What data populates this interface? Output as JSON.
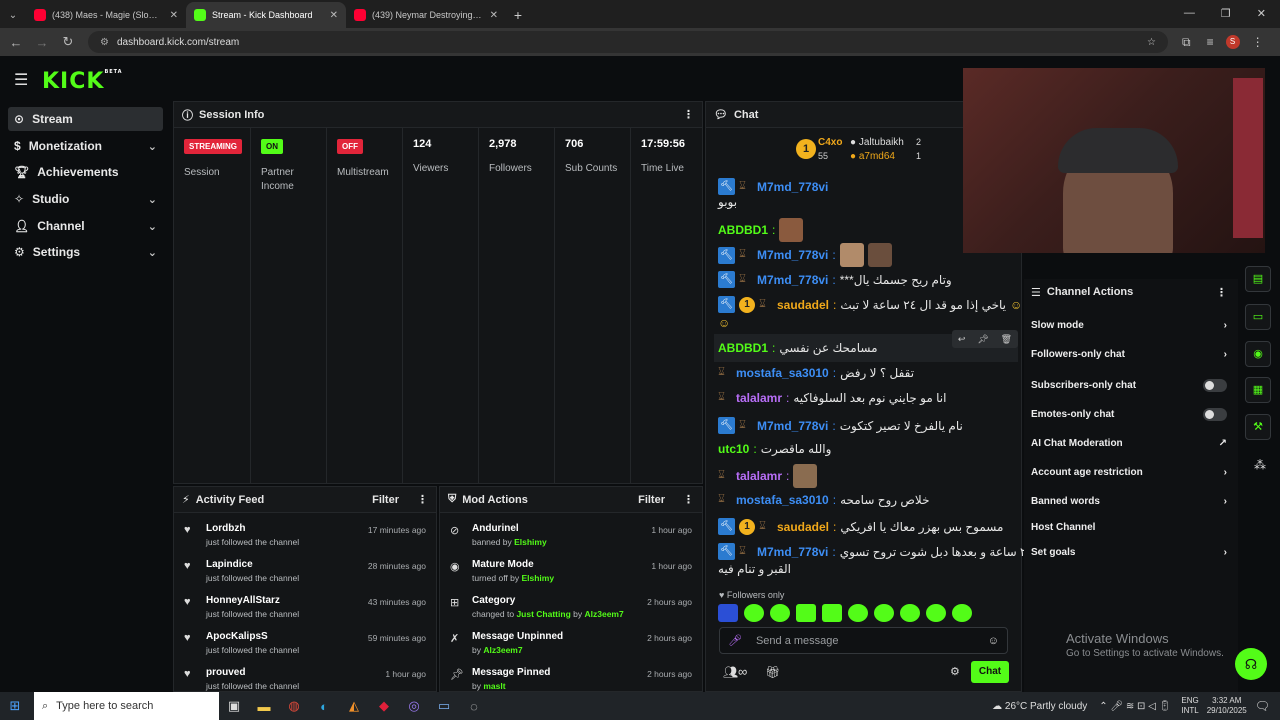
{
  "browser": {
    "tabs": [
      {
        "title": "(438) Maes - Magie (Slowed -",
        "color": "#ff0033"
      },
      {
        "title": "Stream - Kick Dashboard",
        "color": "#53fc18"
      },
      {
        "title": "(439) Neymar Destroying Bayer",
        "color": "#ff0033"
      }
    ],
    "url": "dashboard.kick.com/stream",
    "profile_letter": "S"
  },
  "kick": {
    "logo": "KICK",
    "logo_sup": "BETA"
  },
  "sidebar": {
    "items": [
      {
        "label": "Stream",
        "icon": "radio-icon"
      },
      {
        "label": "Monetization",
        "icon": "dollar-icon"
      },
      {
        "label": "Achievements",
        "icon": "trophy-icon"
      },
      {
        "label": "Studio",
        "icon": "wand-icon"
      },
      {
        "label": "Channel",
        "icon": "person-icon"
      },
      {
        "label": "Settings",
        "icon": "gear-icon"
      }
    ]
  },
  "session": {
    "title": "Session Info",
    "cells": [
      {
        "badge": "STREAMING",
        "label": "Session"
      },
      {
        "badge": "ON",
        "label": "Partner Income"
      },
      {
        "badge": "OFF",
        "label": "Multistream"
      },
      {
        "value": "124",
        "label": "Viewers"
      },
      {
        "value": "2,978",
        "label": "Followers"
      },
      {
        "value": "706",
        "label": "Sub Counts"
      },
      {
        "value": "17:59:56",
        "label": "Time Live"
      }
    ]
  },
  "activity": {
    "title": "Activity Feed",
    "filter": "Filter",
    "rows": [
      {
        "name": "Lordbzh",
        "sub": "just followed the channel",
        "time": "17 minutes ago"
      },
      {
        "name": "Lapindice",
        "sub": "just followed the channel",
        "time": "28 minutes ago"
      },
      {
        "name": "HonneyAllStarz",
        "sub": "just followed the channel",
        "time": "43 minutes ago"
      },
      {
        "name": "ApocKalipsS",
        "sub": "just followed the channel",
        "time": "59 minutes ago"
      },
      {
        "name": "prouved",
        "sub": "just followed the channel",
        "time": "1 hour ago"
      }
    ]
  },
  "mod": {
    "title": "Mod Actions",
    "filter": "Filter",
    "rows": [
      {
        "name": "Andurinel",
        "pre": "banned by",
        "by": "Elshimy",
        "time": "1 hour ago"
      },
      {
        "name": "Mature Mode",
        "pre": "turned off by",
        "by": "Elshimy",
        "time": "1 hour ago"
      },
      {
        "name": "Category",
        "pre": "changed to",
        "mid": "Just Chatting",
        "pre2": "by",
        "by": "Alz3eem7",
        "time": "2 hours ago"
      },
      {
        "name": "Message Unpinned",
        "pre": "by",
        "by": "Alz3eem7",
        "time": "2 hours ago"
      },
      {
        "name": "Message Pinned",
        "pre": "by",
        "by": "maslt",
        "time": "2 hours ago"
      }
    ]
  },
  "chat": {
    "title": "Chat",
    "top": {
      "rank": "1",
      "leader": "C4xo",
      "leader_count": "55",
      "g1_name": "Jaltubaikh",
      "g1_count": "2",
      "g2_name": "a7md64",
      "g2_count": "1"
    },
    "messages": [
      {
        "user": "M7md_778vi",
        "text": "بوبو"
      },
      {
        "user": "ABDBD1",
        "text": ""
      },
      {
        "user": "M7md_778vi",
        "text": ""
      },
      {
        "user": "M7md_778vi",
        "text": "***وتام ريح جسمك يال"
      },
      {
        "user": "saudadel",
        "text": "ياخي إذا مو قد ال ٢٤ ساعة لا تبث"
      },
      {
        "user": "ABDBD1",
        "text": "مسامحك عن نفسي"
      },
      {
        "user": "mostafa_sa3010",
        "text": "تقفل ؟ لا رفض"
      },
      {
        "user": "talalamr",
        "text": "انا مو جايني نوم بعد السلوفاكيه"
      },
      {
        "user": "M7md_778vi",
        "text": "نام يالفرخ لا تصير كتكوت"
      },
      {
        "user": "utc10",
        "text": "والله ماقصرت"
      },
      {
        "user": "talalamr",
        "text": ""
      },
      {
        "user": "mostafa_sa3010",
        "text": "خلاص روح سامحه"
      },
      {
        "user": "saudadel",
        "text": "مسموح بس بهزر معاك يا افريكي"
      },
      {
        "user": "M7md_778vi",
        "text": "٢٤ ساعة و بعدها دبل شوت تروح تسوي"
      },
      {
        "user": "",
        "text": "القبر و تنام فيه"
      }
    ],
    "followers_only": "Followers only",
    "placeholder": "Send a message",
    "send_label": "Chat"
  },
  "channel_actions": {
    "title": "Channel Actions",
    "items": [
      {
        "label": "Slow mode",
        "control": "chevron"
      },
      {
        "label": "Followers-only chat",
        "control": "chevron"
      },
      {
        "label": "Subscribers-only chat",
        "control": "toggle"
      },
      {
        "label": "Emotes-only chat",
        "control": "toggle"
      },
      {
        "label": "AI Chat Moderation",
        "control": "external"
      },
      {
        "label": "Account age restriction",
        "control": "chevron"
      },
      {
        "label": "Banned words",
        "control": "chevron"
      },
      {
        "label": "Host Channel",
        "control": "none"
      },
      {
        "label": "Set goals",
        "control": "chevron"
      }
    ]
  },
  "watermark": {
    "title": "Activate Windows",
    "sub": "Go to Settings to activate Windows."
  },
  "taskbar": {
    "search": "Type here to search",
    "weather": "26°C  Partly cloudy",
    "lang": "ENG",
    "lang2": "INTL",
    "time": "3:32 AM",
    "date": "29/10/2025"
  }
}
